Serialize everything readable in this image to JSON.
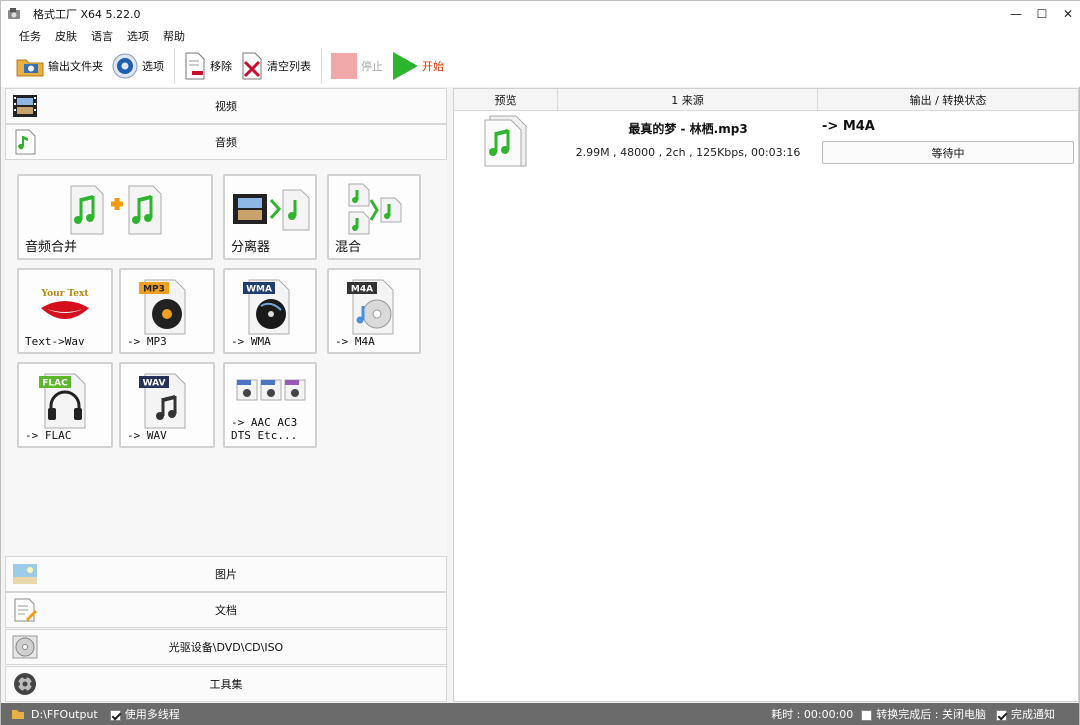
{
  "window": {
    "title": "格式工厂 X64 5.22.0",
    "minimize": "—",
    "maximize": "☐",
    "close": "✕"
  },
  "menu": [
    "任务",
    "皮肤",
    "语言",
    "选项",
    "帮助"
  ],
  "toolbar": {
    "output_folder": "输出文件夹",
    "options": "选项",
    "remove": "移除",
    "clear_list": "清空列表",
    "stop": "停止",
    "start": "开始"
  },
  "categories": {
    "video": "视频",
    "audio": "音频",
    "image": "图片",
    "document": "文档",
    "optical": "光驱设备\\DVD\\CD\\ISO",
    "tools": "工具集"
  },
  "audio_tools": {
    "merge": "音频合并",
    "splitter": "分离器",
    "mix": "混合",
    "text_wav": "Text->Wav",
    "text_badge": "Your Text",
    "mp3": "-> MP3",
    "mp3_badge": "MP3",
    "wma": "-> WMA",
    "wma_badge": "WMA",
    "m4a": "-> M4A",
    "m4a_badge": "M4A",
    "flac": "-> FLAC",
    "flac_badge": "FLAC",
    "wav": "-> WAV",
    "wav_badge": "WAV",
    "aac": "-> AAC AC3\nDTS Etc..."
  },
  "table": {
    "headers": [
      "预览",
      "1 来源",
      "输出 / 转换状态"
    ],
    "rows": [
      {
        "file_name": "最真的梦 - 林栖.mp3",
        "info": "2.99M , 48000 , 2ch , 125Kbps, 00:03:16",
        "output": "-> M4A",
        "status": "等待中"
      }
    ]
  },
  "statusbar": {
    "output_path": "D:\\FFOutput",
    "multithread": "使用多线程",
    "elapsed": "耗时 : 00:00:00",
    "after_convert": "转换完成后 : 关闭电脑",
    "notify": "完成通知"
  },
  "colors": {
    "accent_green": "#2db52d",
    "start_text": "#d13a00",
    "statusbar": "#6b6b6b"
  }
}
